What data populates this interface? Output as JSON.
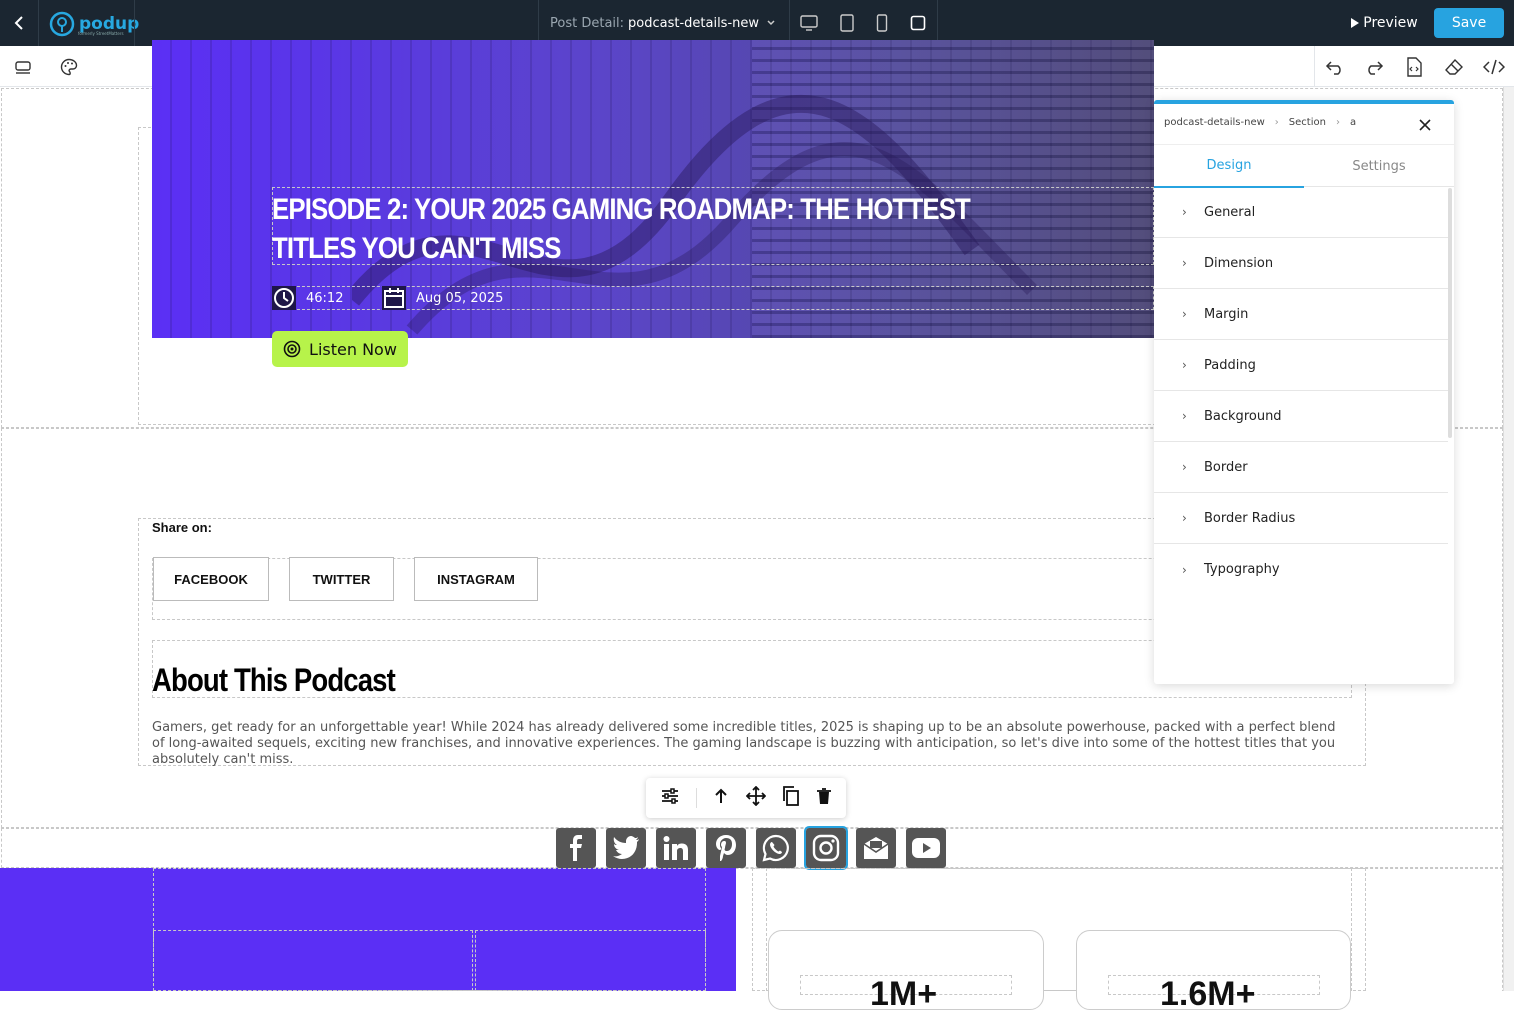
{
  "topbar": {
    "logo_text": "podup",
    "logo_sub": "formerly StreetMatters",
    "post_label": "Post Detail:",
    "post_value": "podcast-details-new",
    "preview_label": "Preview",
    "save_label": "Save"
  },
  "hero": {
    "title": "EPISODE 2: YOUR 2025 GAMING ROADMAP: THE HOTTEST TITLES YOU CAN'T MISS",
    "duration": "46:12",
    "date": "Aug 05, 2025",
    "listen_label": "Listen Now"
  },
  "share": {
    "label": "Share on:",
    "buttons": [
      "FACEBOOK",
      "TWITTER",
      "INSTAGRAM"
    ]
  },
  "about": {
    "heading": "About This Podcast",
    "text": "Gamers, get ready for an unforgettable year! While 2024 has already delivered some incredible titles, 2025 is shaping up to be an absolute powerhouse, packed with a perfect blend of long-awaited sequels, exciting new franchises, and innovative experiences. The gaming landscape is buzzing with anticipation, so let's dive into some of the hottest titles that you absolutely can't miss."
  },
  "stats": [
    "1M+",
    "1.6M+"
  ],
  "panel": {
    "crumbs": [
      "podcast-details-new",
      "Section",
      "a"
    ],
    "tabs": [
      "Design",
      "Settings"
    ],
    "items": [
      "General",
      "Dimension",
      "Margin",
      "Padding",
      "Background",
      "Border",
      "Border Radius",
      "Typography"
    ]
  },
  "colors": {
    "accent": "#27a3e0",
    "hero_purple": "#5b2ff5",
    "listen_green": "#b7f34a",
    "topbar_bg": "#1b2631"
  }
}
